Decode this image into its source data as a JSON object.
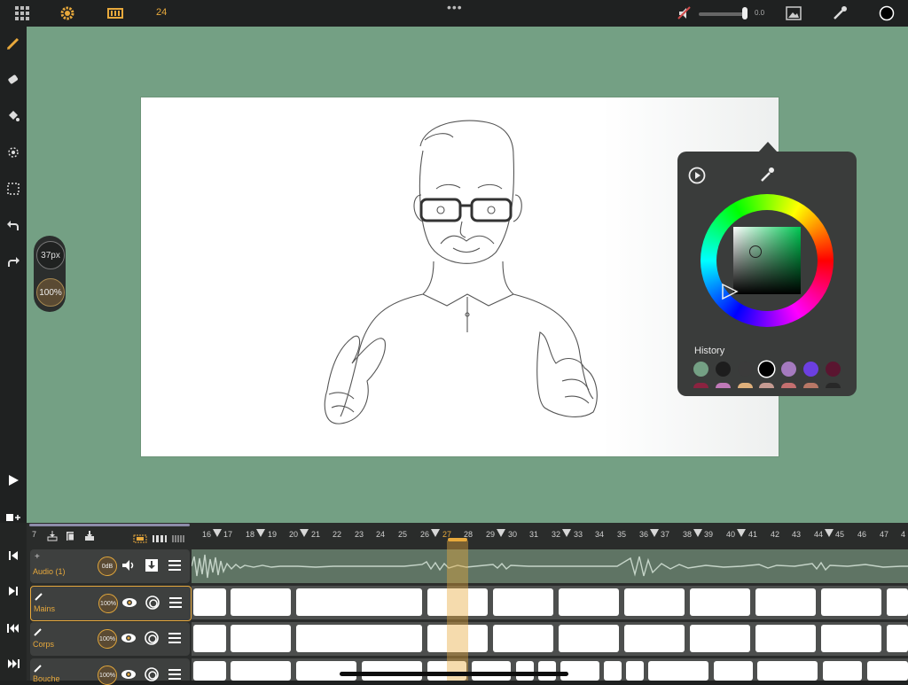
{
  "topbar": {
    "fps_label": "24",
    "volume_value": "0.0",
    "icons": [
      "grid-icon",
      "gear-icon",
      "film-icon",
      "more-dots-icon",
      "mute-icon",
      "image-icon",
      "eyedropper-icon",
      "color-swatch-icon"
    ],
    "accent_color": "#e8a93c"
  },
  "left_toolbar": {
    "tools": [
      "pencil-icon",
      "eraser-icon",
      "fill-icon",
      "lasso-icon",
      "select-icon",
      "undo-icon",
      "redo-icon"
    ],
    "bottom": [
      "play-icon",
      "add-frame-icon"
    ]
  },
  "brush": {
    "size_label": "37px",
    "opacity_label": "100%"
  },
  "color_picker": {
    "history_label": "History",
    "selected_color": "#000000",
    "history": [
      "#74a084",
      "#1d1d1d",
      "#3b3b3b",
      "#000000",
      "#a57abf",
      "#6c3fe0",
      "#5a1530"
    ],
    "history_row2": [
      "#8b2340",
      "#c079b8",
      "#dfb07b",
      "#c69b92",
      "#c46f6f",
      "#b87766",
      "#282828"
    ]
  },
  "timeline": {
    "current_frame_label": "7",
    "frame_numbers": [
      "16",
      "17",
      "18",
      "19",
      "20",
      "21",
      "22",
      "23",
      "24",
      "25",
      "26",
      "27",
      "28",
      "29",
      "30",
      "31",
      "32",
      "33",
      "34",
      "35",
      "36",
      "37",
      "38",
      "39",
      "40",
      "41",
      "42",
      "43",
      "44",
      "45",
      "46",
      "47",
      "4"
    ],
    "layers": [
      {
        "name": "Audio (1)",
        "level": "0dB"
      },
      {
        "name": "Mains",
        "opacity": "100%"
      },
      {
        "name": "Corps",
        "opacity": "100%"
      },
      {
        "name": "Bouche",
        "opacity": "100%"
      }
    ]
  }
}
